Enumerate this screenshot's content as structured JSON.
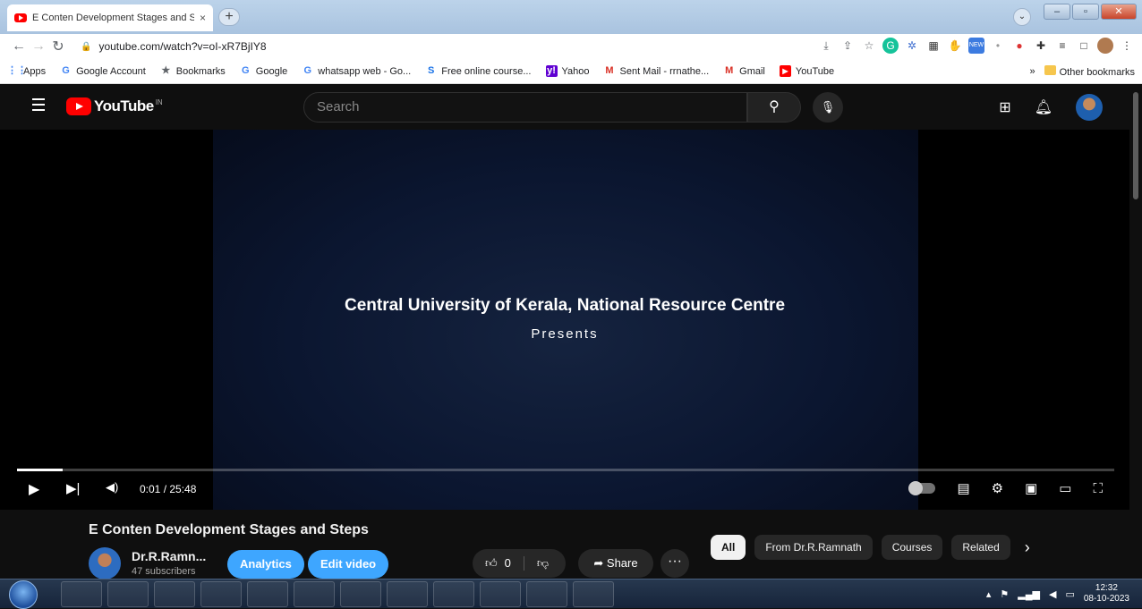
{
  "browser": {
    "tab_title": "E Conten Development Stages and Steps - YouTube",
    "tab_close": "×",
    "new_tab": "+",
    "url": "youtube.com/watch?v=oI-xR7BjIY8",
    "win_min": "–",
    "win_max": "▫",
    "win_close": "✕",
    "bookmarks": [
      {
        "label": "Apps",
        "icon": "apps-grid-icon",
        "color": "#4285f4"
      },
      {
        "label": "Google Account",
        "icon": "google-g-icon",
        "color": "#4285f4"
      },
      {
        "label": "Bookmarks",
        "icon": "star-icon",
        "color": "#5f6368"
      },
      {
        "label": "Google",
        "icon": "google-g-icon",
        "color": "#4285f4"
      },
      {
        "label": "whatsapp web - Go...",
        "icon": "google-g-icon",
        "color": "#4285f4"
      },
      {
        "label": "Free online course...",
        "icon": "s-logo-icon",
        "color": "#1a73e8"
      },
      {
        "label": "Yahoo",
        "icon": "yahoo-icon",
        "color": "#6001d2"
      },
      {
        "label": "Sent Mail - rrnathe...",
        "icon": "gmail-icon",
        "color": "#d93025"
      },
      {
        "label": "Gmail",
        "icon": "gmail-icon",
        "color": "#d93025"
      },
      {
        "label": "YouTube",
        "icon": "youtube-icon",
        "color": "#ff0000"
      }
    ],
    "more_bookmarks": "»",
    "other_bookmarks": "Other bookmarks"
  },
  "youtube": {
    "logo_text": "YouTube",
    "country": "IN",
    "search_placeholder": "Search"
  },
  "video": {
    "overlay_title": "Central University of Kerala, National Resource Centre",
    "overlay_subtitle": "Presents",
    "current_time": "0:01 / 25:48",
    "progress_fraction": 0.042
  },
  "details": {
    "title": "E Conten Development Stages and Steps",
    "channel_name": "Dr.R.Ramn...",
    "subscribers": "47 subscribers",
    "analytics_label": "Analytics",
    "edit_label": "Edit video",
    "like_count": "0",
    "share_label": "Share",
    "more_label": "···"
  },
  "chips": [
    "All",
    "From Dr.R.Ramnath",
    "Courses",
    "Related"
  ],
  "taskbar": {
    "time": "12:32",
    "date": "08-10-2023"
  },
  "colors": {
    "yt_red": "#ff0000",
    "accent_blue": "#3ea6ff"
  }
}
